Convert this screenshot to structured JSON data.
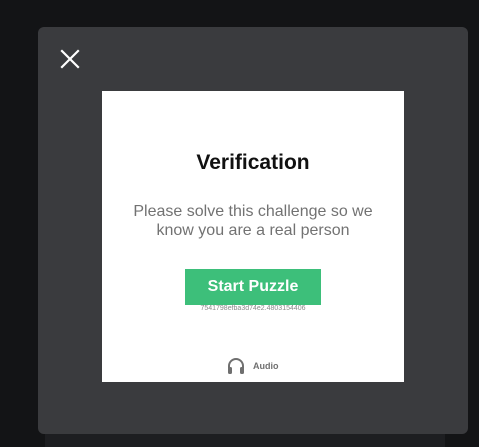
{
  "modal": {
    "close_icon": "close-icon",
    "close_color": "#ffffff",
    "background": "#3a3b3e"
  },
  "challenge": {
    "title": "Verification",
    "description": "Please solve this challenge so we know you are a real person",
    "start_button_label": "Start Puzzle",
    "start_button_color": "#3dbf7a",
    "session_id": "7541798efba3d74e2.4803154406",
    "audio_label": "Audio",
    "audio_icon": "headphones-icon"
  }
}
